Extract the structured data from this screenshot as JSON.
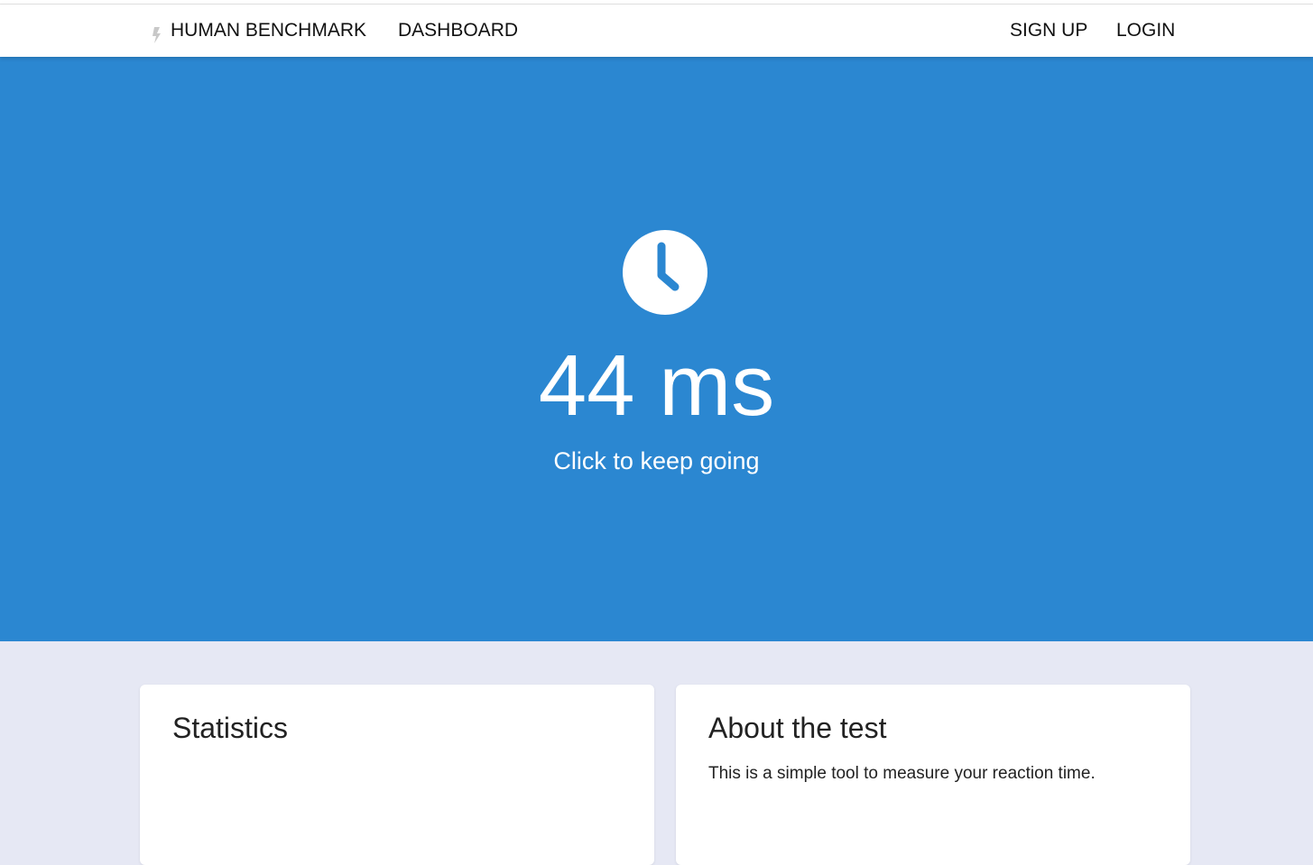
{
  "nav": {
    "brand": "HUMAN BENCHMARK",
    "dashboard": "DASHBOARD",
    "signup": "SIGN UP",
    "login": "LOGIN"
  },
  "hero": {
    "icon": "clock-icon",
    "result": "44 ms",
    "prompt": "Click to keep going",
    "background_color": "#2b87d1"
  },
  "cards": {
    "statistics_title": "Statistics",
    "about_title": "About the test",
    "about_text": "This is a simple tool to measure your reaction time."
  }
}
